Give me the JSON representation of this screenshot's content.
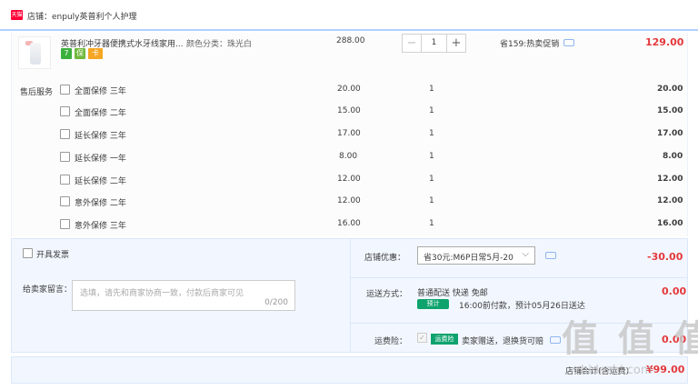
{
  "shop": {
    "badge": "天猫",
    "name": "店铺：enpuly英普利个人护理"
  },
  "product": {
    "title": "英普利冲牙器便携式水牙线家用...",
    "spec": "颜色分类：珠光白",
    "unit_price": "288.00",
    "quantity": "1",
    "promotion": "省159:热卖促销",
    "subtotal": "129.00",
    "tags": [
      "7",
      "保",
      "卡"
    ]
  },
  "services": {
    "label": "售后服务",
    "items": [
      {
        "name": "全面保修 三年",
        "price": "20.00",
        "qty": "1",
        "total": "20.00"
      },
      {
        "name": "全面保修 二年",
        "price": "15.00",
        "qty": "1",
        "total": "15.00"
      },
      {
        "name": "延长保修 三年",
        "price": "17.00",
        "qty": "1",
        "total": "17.00"
      },
      {
        "name": "延长保修 一年",
        "price": "8.00",
        "qty": "1",
        "total": "8.00"
      },
      {
        "name": "延长保修 二年",
        "price": "12.00",
        "qty": "1",
        "total": "12.00"
      },
      {
        "name": "意外保修 二年",
        "price": "12.00",
        "qty": "1",
        "total": "12.00"
      },
      {
        "name": "意外保修 三年",
        "price": "16.00",
        "qty": "1",
        "total": "16.00"
      }
    ]
  },
  "invoice": {
    "label": "开具发票"
  },
  "message": {
    "label": "给卖家留言：",
    "placeholder": "选填，请先和商家协商一致，付款后商家可见",
    "counter": "0/200"
  },
  "discount": {
    "label": "店铺优惠：",
    "selected": "省30元:M6P日常5月-20",
    "amount": "-30.00"
  },
  "shipping": {
    "label": "运送方式：",
    "method": "普通配送 快递 免邮",
    "badge": "预计",
    "eta": "16:00前付款，预计05月26日送达",
    "cost": "0.00"
  },
  "insurance": {
    "label": "运费险：",
    "badge": "运费险",
    "text": "卖家赠送，退换货可赔",
    "cost": "0.00"
  },
  "total": {
    "label": "店铺合计(含运费)",
    "amount": "¥99.00"
  },
  "watermark": {
    "text": "值 值 值",
    "sub": "zhidezhi.com"
  },
  "colors": {
    "accent": "#e4393c",
    "panel_bg": "#f2f7ff",
    "badge_green": "#0ea36d"
  }
}
